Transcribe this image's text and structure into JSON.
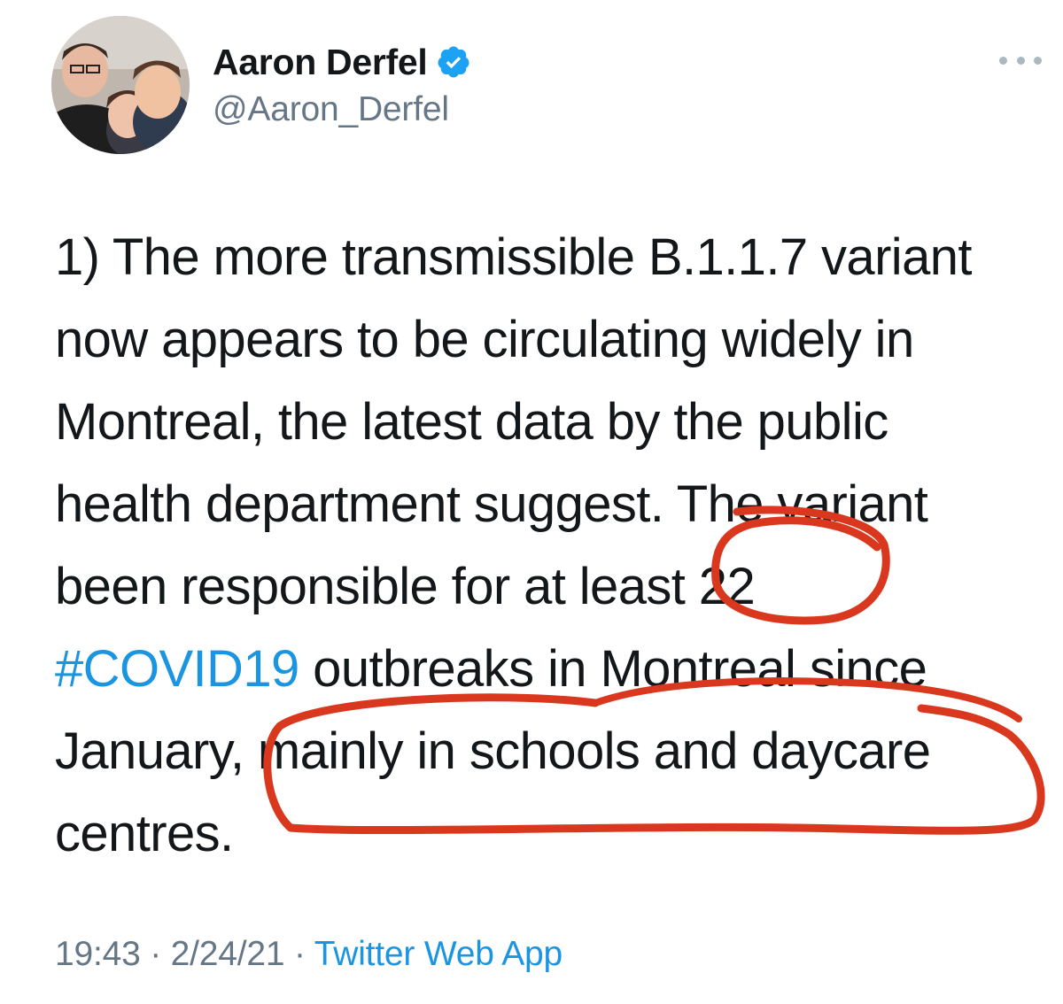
{
  "author": {
    "display_name": "Aaron Derfel",
    "handle": "@Aaron_Derfel",
    "verified": true,
    "avatar_icon": "profile-photo"
  },
  "more_icon": "ellipsis-icon",
  "tweet": {
    "lines": [
      {
        "text": "1) The more transmissible B.1.1.7 variant"
      },
      {
        "text": "now appears to be circulating widely in"
      },
      {
        "text": "Montreal, the latest data by the public"
      },
      {
        "text": "health department suggest. The variant"
      },
      {
        "text": "been responsible for at least 22"
      },
      {
        "hashtag": "#COVID19",
        "text": " outbreaks in Montreal since"
      },
      {
        "text": "January, mainly in schools and daycare"
      },
      {
        "text": "centres."
      }
    ]
  },
  "meta": {
    "time": "19:43",
    "separator1": " · ",
    "date": "2/24/21",
    "separator2": " · ",
    "source": "Twitter Web App"
  },
  "colors": {
    "link": "#1b95e0",
    "verified_badge": "#1da1f2",
    "secondary_text": "#657786",
    "annotation": "#d9381e"
  }
}
